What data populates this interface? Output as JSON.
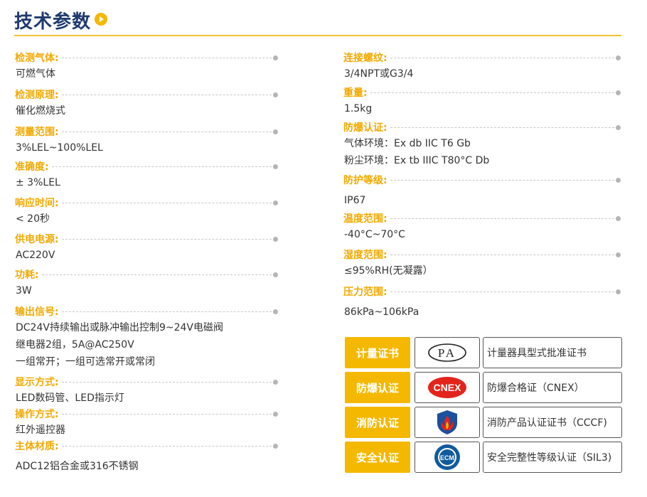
{
  "header": {
    "title": "技术参数"
  },
  "left_specs": [
    {
      "label": "检测气体:",
      "values": [
        "可燃气体"
      ]
    },
    {
      "label": "检测原理:",
      "values": [
        "催化燃烧式"
      ]
    },
    {
      "label": "测量范围:",
      "values": [
        "3%LEL~100%LEL"
      ]
    },
    {
      "label": "准确度:",
      "values": [
        "± 3%LEL"
      ]
    },
    {
      "label": "响应时间:",
      "values": [
        "< 20秒"
      ]
    },
    {
      "label": "供电电源:",
      "values": [
        "AC220V"
      ]
    },
    {
      "label": "功耗:",
      "values": [
        "3W"
      ]
    },
    {
      "label": "输出信号:",
      "values": [
        "DC24V持续输出或脉冲输出控制9~24V电磁阀",
        "继电器2组，5A@AC250V",
        "一组常开；一组可选常开或常闭"
      ]
    },
    {
      "label": "显示方式:",
      "values": [
        "LED数码管、LED指示灯"
      ]
    },
    {
      "label": "操作方式:",
      "values": [
        "红外遥控器"
      ]
    },
    {
      "label": "主体材质:",
      "values": [
        "ADC12铝合金或316不锈钢"
      ]
    }
  ],
  "right_specs": [
    {
      "label": "连接螺纹:",
      "values": [
        "3/4NPT或G3/4"
      ]
    },
    {
      "label": "重量:",
      "values": [
        "1.5kg"
      ]
    },
    {
      "label": "防爆认证:",
      "values": [
        "气体环境：Ex db IIC T6 Gb",
        "粉尘环境：Ex tb IIIC T80°C Db"
      ]
    },
    {
      "label": "防护等级:",
      "values": [
        "IP67"
      ]
    },
    {
      "label": "温度范围:",
      "values": [
        "-40°C~70°C"
      ]
    },
    {
      "label": "湿度范围:",
      "values": [
        "≤95%RH(无凝露）"
      ]
    },
    {
      "label": "压力范围:",
      "values": [
        "86kPa~106kPa"
      ]
    }
  ],
  "certs": [
    {
      "tag": "计量证书",
      "logo_icon": "pa-metrology-icon",
      "logo_text": "PA",
      "desc": "计量器具型式批准证书"
    },
    {
      "tag": "防爆认证",
      "logo_icon": "cnex-icon",
      "logo_text": "CNEX",
      "desc": "防爆合格证（CNEX）"
    },
    {
      "tag": "消防认证",
      "logo_icon": "cccf-fire-shield-icon",
      "logo_text": "",
      "desc": "消防产品认证证书（CCCF)"
    },
    {
      "tag": "安全认证",
      "logo_icon": "ecm-sil-seal-icon",
      "logo_text": "ECM",
      "desc": "安全完整性等级认证（SIL3)"
    }
  ],
  "colors": {
    "accent": "#f5b800",
    "label": "#f2a900",
    "title": "#1e3a6e",
    "text": "#333333",
    "cnex_red": "#e3241b",
    "cccf_blue": "#1c4f9c",
    "ecm_blue": "#0f5b9e"
  }
}
